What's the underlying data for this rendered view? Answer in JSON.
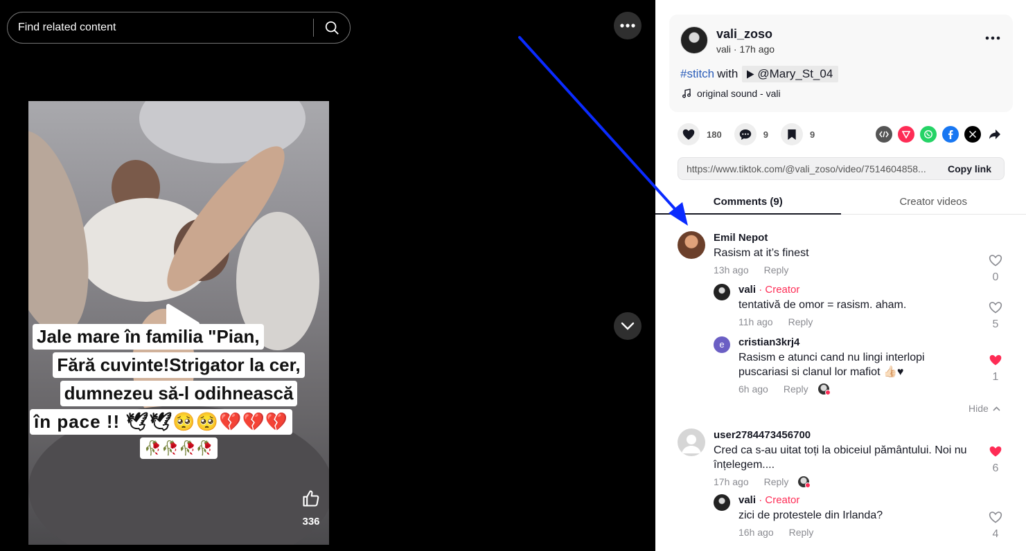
{
  "search": {
    "placeholder": "Find related content"
  },
  "video": {
    "caption_lines": [
      "Jale mare în familia \"Pian,",
      "Fără cuvinte!Strigator la cer,",
      "dumnezeu să-l odihnească",
      "în pace !! 🕊🕊🥺🥺💔💔💔",
      "🥀🥀🥀🥀"
    ],
    "like_count": "336"
  },
  "post": {
    "author_name": "vali_zoso",
    "author_nick": "vali",
    "posted_ago": "17h ago",
    "hashtag": "#stitch",
    "with_text": "with",
    "stitch_user": "@Mary_St_04",
    "sound": "original sound - vali"
  },
  "actions": {
    "likes": "180",
    "comments": "9",
    "saves": "9"
  },
  "share": {
    "icons": [
      "embed-icon",
      "repost-icon",
      "whatsapp-icon",
      "facebook-icon",
      "x-icon",
      "share-icon"
    ],
    "colors": {
      "embed": "#555555",
      "repost": "#fe2c55",
      "whatsapp": "#25d366",
      "facebook": "#1877f2",
      "x": "#000000"
    }
  },
  "link": {
    "url": "https://www.tiktok.com/@vali_zoso/video/7514604858...",
    "copy_label": "Copy link"
  },
  "tabs": [
    {
      "label": "Comments (9)",
      "active": true
    },
    {
      "label": "Creator videos",
      "active": false
    }
  ],
  "comments": [
    {
      "user": "Emil Nepot",
      "text": "Rasism at it’s finest",
      "time": "13h ago",
      "reply": "Reply",
      "likes": "0",
      "liked": false
    },
    {
      "user": "vali",
      "creator_tag": " · Creator",
      "text": "tentativă de omor = rasism. aham.",
      "time": "11h ago",
      "reply": "Reply",
      "likes": "5",
      "liked": false
    },
    {
      "user": "cristian3krj4",
      "avatar_letter": "e",
      "text": "Rasism e atunci cand nu lingi interlopi puscariasi si clanul lor mafiot 👍🏻♥",
      "time": "6h ago",
      "reply": "Reply",
      "likes": "1",
      "liked": true
    },
    {
      "user": "user2784473456700",
      "text": "Cred ca s-au uitat toți la obiceiul pământului. Noi nu înțelegem....",
      "time": "17h ago",
      "reply": "Reply",
      "likes": "6",
      "liked": true
    },
    {
      "user": "vali",
      "creator_tag": " · Creator",
      "text": "zici de protestele din Irlanda?",
      "time": "16h ago",
      "reply": "Reply",
      "likes": "4",
      "liked": false
    }
  ],
  "hide_label": "Hide",
  "colors": {
    "accent": "#fe2c55",
    "hashtag": "#2b5db9",
    "annotation_arrow": "#0a2bff"
  }
}
